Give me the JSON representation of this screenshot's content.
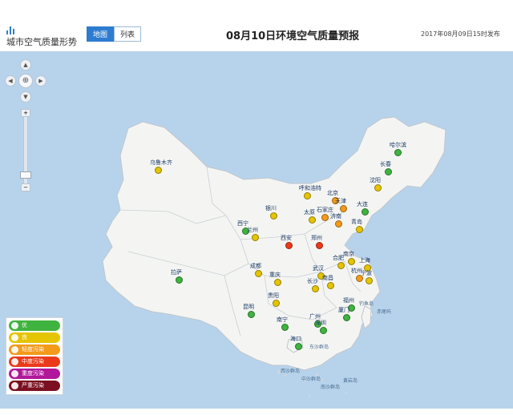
{
  "app": {
    "title": "城市空气质量形势"
  },
  "tabs": [
    {
      "label": "地图",
      "active": true
    },
    {
      "label": "列表",
      "active": false
    }
  ],
  "page_title": "08月10日环境空气质量预报",
  "publish_time": "2017年08月09日15时发布",
  "legend": [
    {
      "label": "优",
      "color": "#3fb33f"
    },
    {
      "label": "良",
      "color": "#e5c400"
    },
    {
      "label": "轻度污染",
      "color": "#f39a1b"
    },
    {
      "label": "中度污染",
      "color": "#ea3a1a"
    },
    {
      "label": "重度污染",
      "color": "#b0179a"
    },
    {
      "label": "严重污染",
      "color": "#7a1020"
    }
  ],
  "cities": [
    {
      "name": "乌鲁木齐",
      "level": "良"
    },
    {
      "name": "哈尔滨",
      "level": "优"
    },
    {
      "name": "长春",
      "level": "优"
    },
    {
      "name": "沈阳",
      "level": "良"
    },
    {
      "name": "呼和浩特",
      "level": "良"
    },
    {
      "name": "北京",
      "level": "轻度污染"
    },
    {
      "name": "天津",
      "level": "轻度污染"
    },
    {
      "name": "石家庄",
      "level": "轻度污染"
    },
    {
      "name": "太原",
      "level": "良"
    },
    {
      "name": "大连",
      "level": "优"
    },
    {
      "name": "济南",
      "level": "轻度污染"
    },
    {
      "name": "青岛",
      "level": "良"
    },
    {
      "name": "银川",
      "level": "良"
    },
    {
      "name": "西宁",
      "level": "优"
    },
    {
      "name": "兰州",
      "level": "良"
    },
    {
      "name": "西安",
      "level": "中度污染"
    },
    {
      "name": "郑州",
      "level": "中度污染"
    },
    {
      "name": "南京",
      "level": "良"
    },
    {
      "name": "合肥",
      "level": "良"
    },
    {
      "name": "上海",
      "level": "良"
    },
    {
      "name": "杭州",
      "level": "轻度污染"
    },
    {
      "name": "宁波",
      "level": "良"
    },
    {
      "name": "武汉",
      "level": "良"
    },
    {
      "name": "成都",
      "level": "良"
    },
    {
      "name": "重庆",
      "level": "良"
    },
    {
      "name": "长沙",
      "level": "良"
    },
    {
      "name": "南昌",
      "level": "良"
    },
    {
      "name": "拉萨",
      "level": "优"
    },
    {
      "name": "贵阳",
      "level": "良"
    },
    {
      "name": "福州",
      "level": "优"
    },
    {
      "name": "厦门",
      "level": "优"
    },
    {
      "name": "昆明",
      "level": "优"
    },
    {
      "name": "南宁",
      "level": "优"
    },
    {
      "name": "广州",
      "level": "优"
    },
    {
      "name": "深圳",
      "level": "优"
    },
    {
      "name": "海口",
      "level": "优"
    }
  ],
  "sea_labels": [
    "钓鱼岛",
    "赤尾屿",
    "东沙群岛",
    "西沙群岛",
    "中沙群岛",
    "黄岩岛",
    "南沙群岛"
  ]
}
